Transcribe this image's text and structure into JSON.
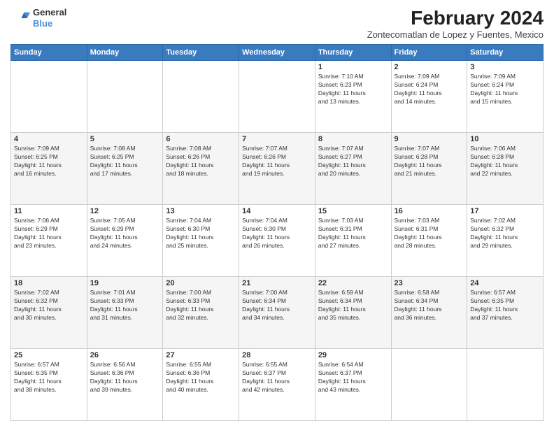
{
  "header": {
    "logo": {
      "line1": "General",
      "line2": "Blue"
    },
    "title": "February 2024",
    "subtitle": "Zontecomatlan de Lopez y Fuentes, Mexico"
  },
  "weekdays": [
    "Sunday",
    "Monday",
    "Tuesday",
    "Wednesday",
    "Thursday",
    "Friday",
    "Saturday"
  ],
  "weeks": [
    [
      {
        "day": "",
        "info": ""
      },
      {
        "day": "",
        "info": ""
      },
      {
        "day": "",
        "info": ""
      },
      {
        "day": "",
        "info": ""
      },
      {
        "day": "1",
        "info": "Sunrise: 7:10 AM\nSunset: 6:23 PM\nDaylight: 11 hours\nand 13 minutes."
      },
      {
        "day": "2",
        "info": "Sunrise: 7:09 AM\nSunset: 6:24 PM\nDaylight: 11 hours\nand 14 minutes."
      },
      {
        "day": "3",
        "info": "Sunrise: 7:09 AM\nSunset: 6:24 PM\nDaylight: 11 hours\nand 15 minutes."
      }
    ],
    [
      {
        "day": "4",
        "info": "Sunrise: 7:09 AM\nSunset: 6:25 PM\nDaylight: 11 hours\nand 16 minutes."
      },
      {
        "day": "5",
        "info": "Sunrise: 7:08 AM\nSunset: 6:25 PM\nDaylight: 11 hours\nand 17 minutes."
      },
      {
        "day": "6",
        "info": "Sunrise: 7:08 AM\nSunset: 6:26 PM\nDaylight: 11 hours\nand 18 minutes."
      },
      {
        "day": "7",
        "info": "Sunrise: 7:07 AM\nSunset: 6:26 PM\nDaylight: 11 hours\nand 19 minutes."
      },
      {
        "day": "8",
        "info": "Sunrise: 7:07 AM\nSunset: 6:27 PM\nDaylight: 11 hours\nand 20 minutes."
      },
      {
        "day": "9",
        "info": "Sunrise: 7:07 AM\nSunset: 6:28 PM\nDaylight: 11 hours\nand 21 minutes."
      },
      {
        "day": "10",
        "info": "Sunrise: 7:06 AM\nSunset: 6:28 PM\nDaylight: 11 hours\nand 22 minutes."
      }
    ],
    [
      {
        "day": "11",
        "info": "Sunrise: 7:06 AM\nSunset: 6:29 PM\nDaylight: 11 hours\nand 23 minutes."
      },
      {
        "day": "12",
        "info": "Sunrise: 7:05 AM\nSunset: 6:29 PM\nDaylight: 11 hours\nand 24 minutes."
      },
      {
        "day": "13",
        "info": "Sunrise: 7:04 AM\nSunset: 6:30 PM\nDaylight: 11 hours\nand 25 minutes."
      },
      {
        "day": "14",
        "info": "Sunrise: 7:04 AM\nSunset: 6:30 PM\nDaylight: 11 hours\nand 26 minutes."
      },
      {
        "day": "15",
        "info": "Sunrise: 7:03 AM\nSunset: 6:31 PM\nDaylight: 11 hours\nand 27 minutes."
      },
      {
        "day": "16",
        "info": "Sunrise: 7:03 AM\nSunset: 6:31 PM\nDaylight: 11 hours\nand 28 minutes."
      },
      {
        "day": "17",
        "info": "Sunrise: 7:02 AM\nSunset: 6:32 PM\nDaylight: 11 hours\nand 29 minutes."
      }
    ],
    [
      {
        "day": "18",
        "info": "Sunrise: 7:02 AM\nSunset: 6:32 PM\nDaylight: 11 hours\nand 30 minutes."
      },
      {
        "day": "19",
        "info": "Sunrise: 7:01 AM\nSunset: 6:33 PM\nDaylight: 11 hours\nand 31 minutes."
      },
      {
        "day": "20",
        "info": "Sunrise: 7:00 AM\nSunset: 6:33 PM\nDaylight: 11 hours\nand 32 minutes."
      },
      {
        "day": "21",
        "info": "Sunrise: 7:00 AM\nSunset: 6:34 PM\nDaylight: 11 hours\nand 34 minutes."
      },
      {
        "day": "22",
        "info": "Sunrise: 6:59 AM\nSunset: 6:34 PM\nDaylight: 11 hours\nand 35 minutes."
      },
      {
        "day": "23",
        "info": "Sunrise: 6:58 AM\nSunset: 6:34 PM\nDaylight: 11 hours\nand 36 minutes."
      },
      {
        "day": "24",
        "info": "Sunrise: 6:57 AM\nSunset: 6:35 PM\nDaylight: 11 hours\nand 37 minutes."
      }
    ],
    [
      {
        "day": "25",
        "info": "Sunrise: 6:57 AM\nSunset: 6:35 PM\nDaylight: 11 hours\nand 38 minutes."
      },
      {
        "day": "26",
        "info": "Sunrise: 6:56 AM\nSunset: 6:36 PM\nDaylight: 11 hours\nand 39 minutes."
      },
      {
        "day": "27",
        "info": "Sunrise: 6:55 AM\nSunset: 6:36 PM\nDaylight: 11 hours\nand 40 minutes."
      },
      {
        "day": "28",
        "info": "Sunrise: 6:55 AM\nSunset: 6:37 PM\nDaylight: 11 hours\nand 42 minutes."
      },
      {
        "day": "29",
        "info": "Sunrise: 6:54 AM\nSunset: 6:37 PM\nDaylight: 11 hours\nand 43 minutes."
      },
      {
        "day": "",
        "info": ""
      },
      {
        "day": "",
        "info": ""
      }
    ]
  ]
}
